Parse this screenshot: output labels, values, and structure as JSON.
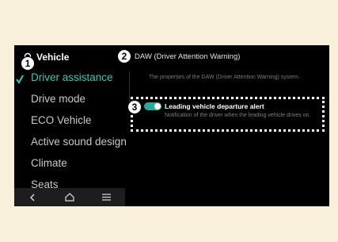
{
  "sidebar": {
    "title": "Vehicle",
    "items": [
      {
        "label": "Driver assistance",
        "active": true
      },
      {
        "label": "Drive mode",
        "active": false
      },
      {
        "label": "ECO Vehicle",
        "active": false
      },
      {
        "label": "Active sound design",
        "active": false
      },
      {
        "label": "Climate",
        "active": false
      },
      {
        "label": "Seats",
        "active": false
      }
    ]
  },
  "content": {
    "title": "DAW (Driver Attention Warning)",
    "description": "The properties of the DAW (Driver Attention Warning) system.",
    "setting": {
      "title": "Leading vehicle departure alert",
      "description": "Notification of the driver when the leading vehicle drives on.",
      "enabled": true
    }
  },
  "callouts": [
    "1",
    "2",
    "3"
  ],
  "colors": {
    "accent": "#35c9b5",
    "toggle": "#2aa89b",
    "background": "#f8f0da"
  }
}
